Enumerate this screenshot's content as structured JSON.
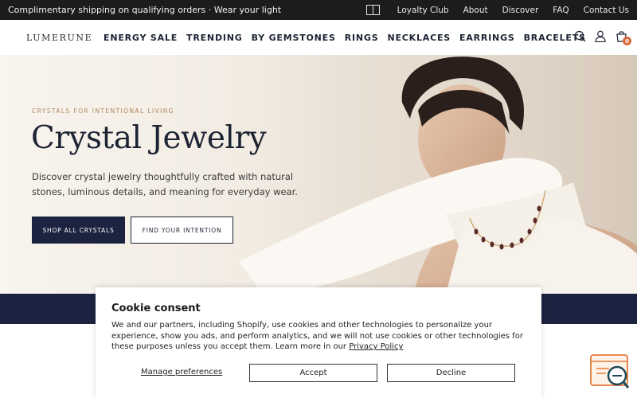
{
  "announcement": {
    "text": "Complimentary shipping on qualifying orders · Wear your light",
    "links": [
      "Loyalty Club",
      "About",
      "Discover",
      "FAQ",
      "Contact Us"
    ]
  },
  "header": {
    "logo": "LUMERUNE",
    "nav": [
      "ENERGY SALE",
      "TRENDING",
      "BY GEMSTONES",
      "RINGS",
      "NECKLACES",
      "EARRINGS",
      "BRACELETS"
    ],
    "cart_count": "0",
    "icons": [
      "search-icon",
      "account-icon",
      "cart-icon"
    ]
  },
  "hero": {
    "eyebrow": "CRYSTALS FOR INTENTIONAL LIVING",
    "title": "Crystal Jewelry",
    "description": "Discover crystal jewelry thoughtfully crafted with natural stones, luminous details, and meaning for everyday wear.",
    "primary_button": "SHOP ALL CRYSTALS",
    "secondary_button": "FIND YOUR INTENTION"
  },
  "cookie": {
    "title": "Cookie consent",
    "text": "We and our partners, including Shopify, use cookies and other technologies to personalize your experience, show you ads, and perform analytics, and we will not use cookies or other technologies for these purposes unless you accept them. Learn more in our",
    "policy_link": "Privacy Policy",
    "manage": "Manage preferences",
    "accept": "Accept",
    "decline": "Decline"
  },
  "colors": {
    "navy": "#1b2340",
    "gold": "#b0875a",
    "badge": "#d86a3a"
  }
}
